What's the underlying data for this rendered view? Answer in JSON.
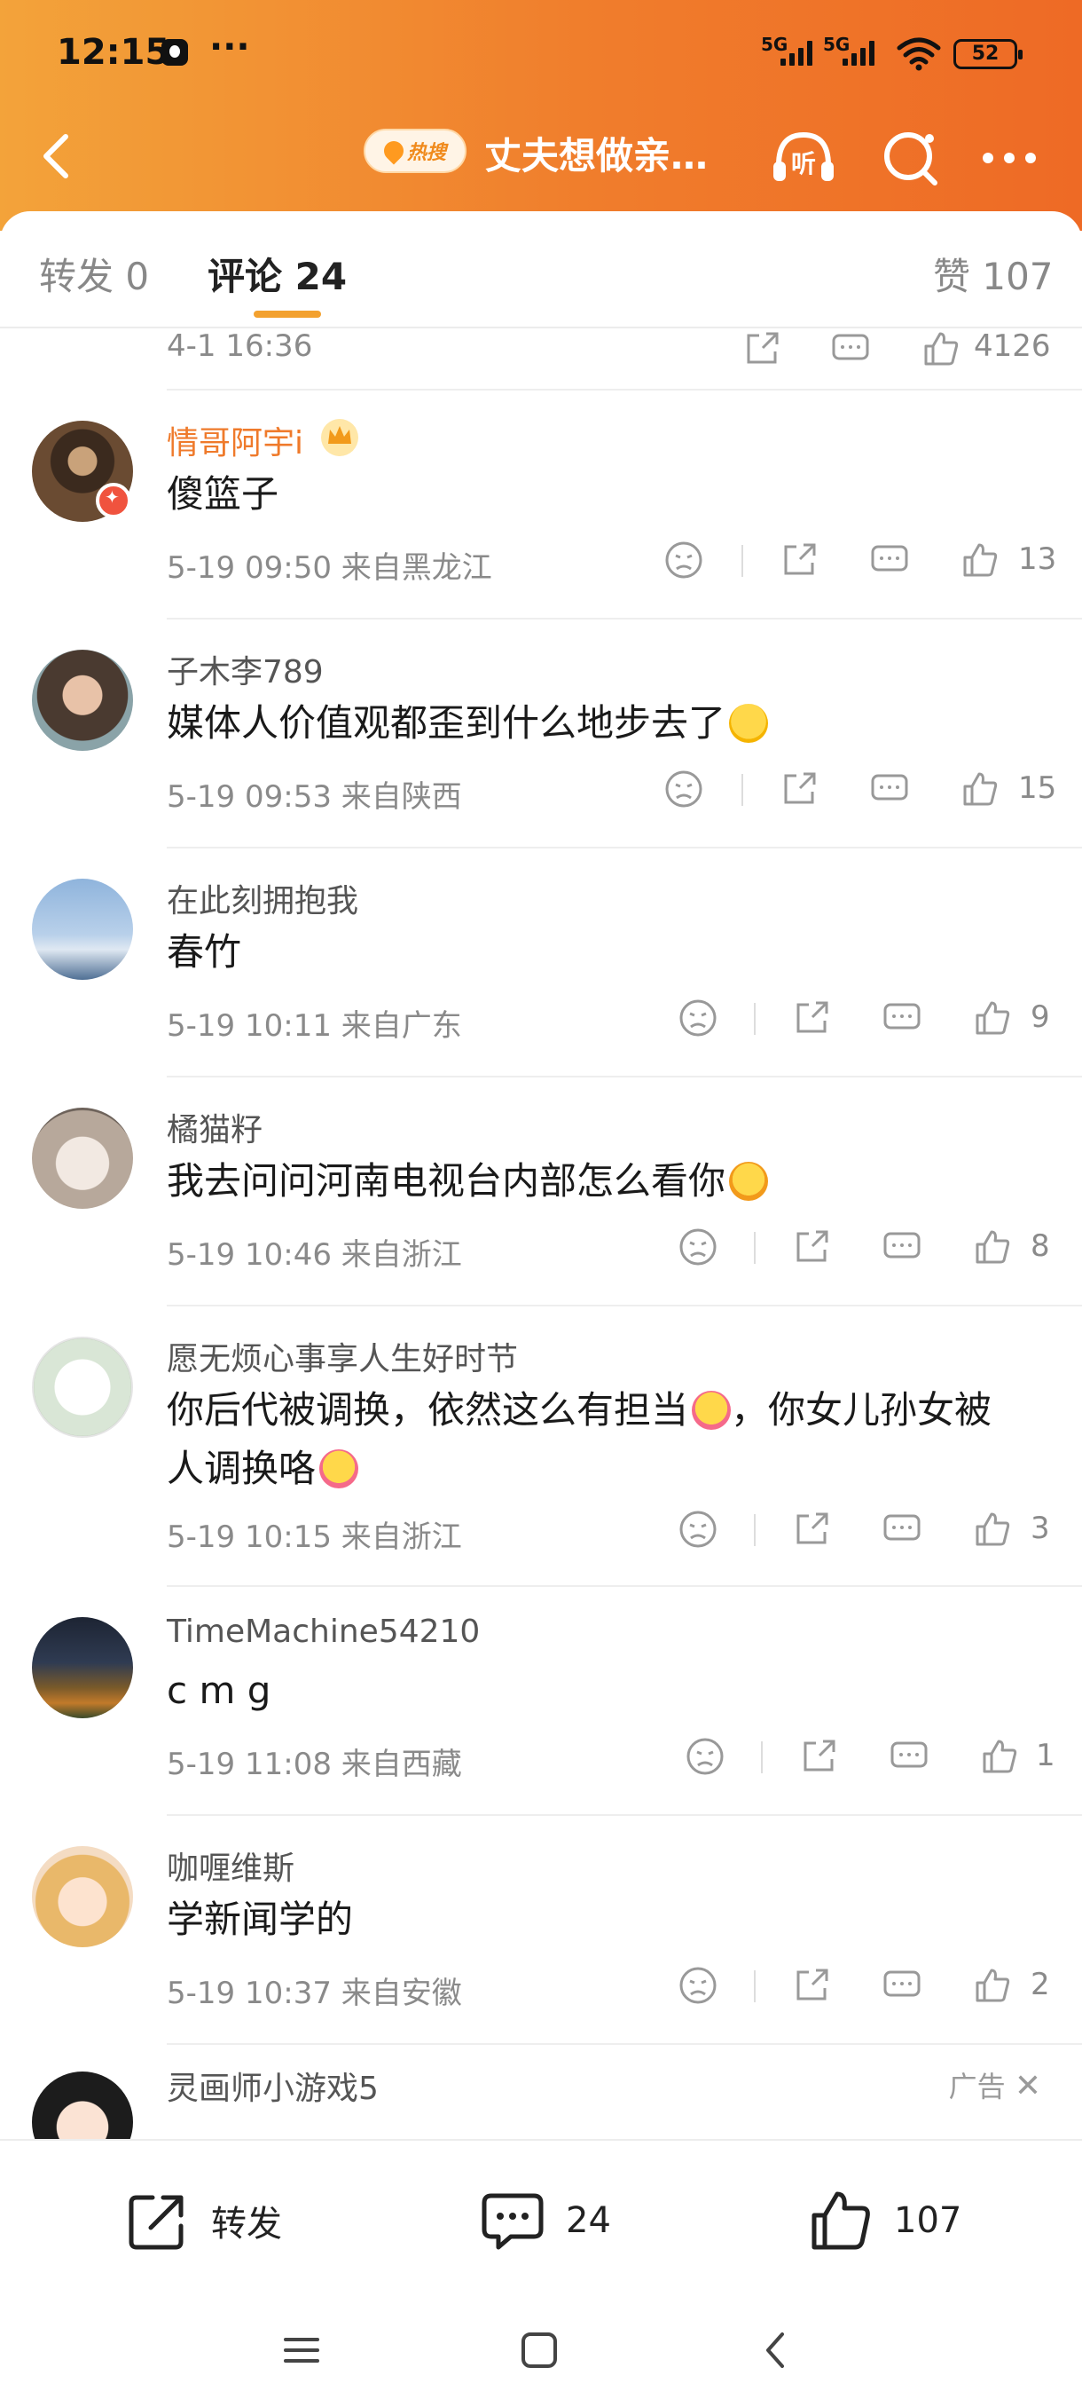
{
  "status_bar": {
    "time": "12:15",
    "more": "···",
    "signal1": "5G",
    "signal2": "5G",
    "battery": "52"
  },
  "nav": {
    "hot_badge": "热搜",
    "title": "丈夫想做亲…",
    "listen_icon": "headphones-listen-icon",
    "search_icon": "search-icon",
    "more_icon": "more-icon"
  },
  "tabs": {
    "repost": "转发 0",
    "comments": "评论 24",
    "likes": "赞 107"
  },
  "partial_row": {
    "meta": "4-1 16:36",
    "likes": "4126"
  },
  "comments": [
    {
      "user": "情哥阿宇i",
      "text": "傻篮子",
      "meta": "5-19 09:50  来自黑龙江",
      "likes": "13"
    },
    {
      "user": "子木李789",
      "text": "媒体人价值观都歪到什么地步去了",
      "meta": "5-19 09:53  来自陕西",
      "likes": "15"
    },
    {
      "user": "在此刻拥抱我",
      "text": "春竹",
      "meta": "5-19 10:11  来自广东",
      "likes": "9"
    },
    {
      "user": "橘猫籽",
      "text": "我去问问河南电视台内部怎么看你",
      "meta": "5-19 10:46  来自浙江",
      "likes": "8"
    },
    {
      "user": "愿无烦心事享人生好时节",
      "text": "你后代被调换，依然这么有担当",
      "text2": "，你女儿孙女被",
      "text3": "人调换咯",
      "meta": "5-19 10:15  来自浙江",
      "likes": "3"
    },
    {
      "user": "TimeMachine54210",
      "text": "c m g",
      "meta": "5-19 11:08  来自西藏",
      "likes": "1"
    },
    {
      "user": "咖喱维斯",
      "text": "学新闻学的",
      "meta": "5-19 10:37  来自安徽",
      "likes": "2"
    }
  ],
  "ad_row": {
    "user": "灵画师小游戏5",
    "ad_label": "广告"
  },
  "bottom_bar": {
    "repost": "转发",
    "comment_count": "24",
    "like_count": "107"
  },
  "colors": {
    "header_start": "#f3a33a",
    "header_end": "#ee6a25",
    "vip_name": "#ef7a2b",
    "tab_underline": "#f3a12f"
  }
}
